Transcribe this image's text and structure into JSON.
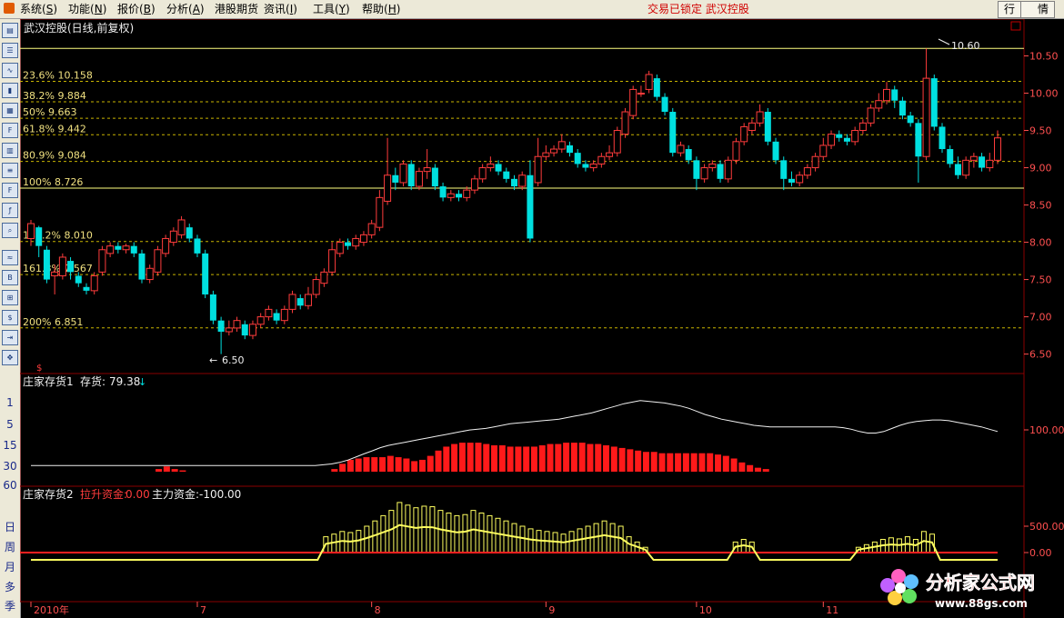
{
  "menu": {
    "items": [
      "系统",
      "功能",
      "报价",
      "分析",
      "港股期货",
      "资讯",
      "工具",
      "帮助"
    ],
    "item_keys": [
      "S",
      "N",
      "B",
      "A",
      "",
      "I",
      "Y",
      "H"
    ],
    "status": "交易已锁定 武汉控股",
    "right_buttons": [
      "行",
      "情"
    ]
  },
  "toolbar": {
    "periods": [
      "1",
      "5",
      "15",
      "30",
      "60"
    ],
    "cycles": [
      "日",
      "周",
      "月",
      "多",
      "季"
    ]
  },
  "main_panel": {
    "title": "武汉控股(日线,前复权)",
    "high_label": "10.60",
    "low_label": "6.50",
    "fib_levels": [
      {
        "label": "23.6% 10.158",
        "price": 10.158
      },
      {
        "label": "38.2% 9.884",
        "price": 9.884
      },
      {
        "label": "50% 9.663",
        "price": 9.663
      },
      {
        "label": "61.8% 9.442",
        "price": 9.442
      },
      {
        "label": "80.9% 9.084",
        "price": 9.084
      },
      {
        "label": "100% 8.726",
        "price": 8.726
      },
      {
        "label": "138.2% 8.010",
        "price": 8.01
      },
      {
        "label": "161.8% 7.567",
        "price": 7.567
      },
      {
        "label": "200% 6.851",
        "price": 6.851
      }
    ],
    "yaxis_ticks": [
      "10.50",
      "10.00",
      "9.50",
      "9.00",
      "8.50",
      "8.00",
      "7.50",
      "7.00",
      "6.50"
    ],
    "yaxis_values": [
      10.5,
      10.0,
      9.5,
      9.0,
      8.5,
      8.0,
      7.5,
      7.0,
      6.5
    ],
    "ymin": 6.3,
    "ymax": 10.75
  },
  "sub_panel_1": {
    "name": "庄家存货1",
    "indicator_label": "存货:",
    "indicator_value": "79.38",
    "tick_label": "100.00",
    "tick_value": 100
  },
  "sub_panel_2": {
    "name": "庄家存货2",
    "pull_label": "拉升资金:",
    "pull_value": "0.00",
    "main_label": "主力资金:",
    "main_value": "-100.00",
    "ticks": [
      "500.00",
      "0.00"
    ],
    "tick_values": [
      500,
      0
    ]
  },
  "xaxis": {
    "labels": [
      {
        "text": "2010年",
        "index": 0
      },
      {
        "text": "7",
        "index": 21
      },
      {
        "text": "8",
        "index": 43
      },
      {
        "text": "9",
        "index": 65
      },
      {
        "text": "10",
        "index": 84
      },
      {
        "text": "11",
        "index": 100
      }
    ]
  },
  "watermark": {
    "title": "分析家公式网",
    "url": "www.88gs.com"
  },
  "colors": {
    "up": "#ff3c3c",
    "down": "#00e0e0",
    "fib_dash": "#c8b400",
    "fib_solid": "#ffff80",
    "grid_red": "#8a0000",
    "axis_text": "#ff5050",
    "cream": "#f0e080"
  },
  "chart_data": {
    "type": "candlestick",
    "candles": [
      [
        8.05,
        8.25,
        8.3,
        7.95
      ],
      [
        8.2,
        7.95,
        8.22,
        7.8
      ],
      [
        7.9,
        7.5,
        7.95,
        7.45
      ],
      [
        7.55,
        7.6,
        7.7,
        7.3
      ],
      [
        7.55,
        7.8,
        7.85,
        7.5
      ],
      [
        7.75,
        7.6,
        7.8,
        7.5
      ],
      [
        7.55,
        7.45,
        7.6,
        7.4
      ],
      [
        7.4,
        7.35,
        7.45,
        7.3
      ],
      [
        7.35,
        7.55,
        7.6,
        7.3
      ],
      [
        7.6,
        7.9,
        7.95,
        7.55
      ],
      [
        7.85,
        7.95,
        8.0,
        7.8
      ],
      [
        7.95,
        7.9,
        8.0,
        7.85
      ],
      [
        7.9,
        7.95,
        7.98,
        7.85
      ],
      [
        7.95,
        7.85,
        8.0,
        7.8
      ],
      [
        7.85,
        7.5,
        7.9,
        7.45
      ],
      [
        7.5,
        7.65,
        7.7,
        7.45
      ],
      [
        7.6,
        7.9,
        7.95,
        7.55
      ],
      [
        7.85,
        8.05,
        8.1,
        7.8
      ],
      [
        8.0,
        8.15,
        8.2,
        7.95
      ],
      [
        8.1,
        8.3,
        8.35,
        8.05
      ],
      [
        8.2,
        8.05,
        8.25,
        8.0
      ],
      [
        8.05,
        7.85,
        8.1,
        7.8
      ],
      [
        7.85,
        7.3,
        7.9,
        7.25
      ],
      [
        7.3,
        6.95,
        7.35,
        6.9
      ],
      [
        6.95,
        6.8,
        7.0,
        6.5
      ],
      [
        6.8,
        6.85,
        6.95,
        6.75
      ],
      [
        6.85,
        6.95,
        7.0,
        6.8
      ],
      [
        6.9,
        6.75,
        6.95,
        6.7
      ],
      [
        6.75,
        6.9,
        6.95,
        6.7
      ],
      [
        6.9,
        7.0,
        7.05,
        6.85
      ],
      [
        7.0,
        7.1,
        7.15,
        6.95
      ],
      [
        7.05,
        6.95,
        7.1,
        6.9
      ],
      [
        6.95,
        7.1,
        7.15,
        6.9
      ],
      [
        7.1,
        7.3,
        7.35,
        7.05
      ],
      [
        7.25,
        7.15,
        7.3,
        7.1
      ],
      [
        7.15,
        7.3,
        7.4,
        7.1
      ],
      [
        7.3,
        7.5,
        7.55,
        7.25
      ],
      [
        7.45,
        7.6,
        7.65,
        7.4
      ],
      [
        7.6,
        7.9,
        8.0,
        7.55
      ],
      [
        7.85,
        8.0,
        8.05,
        7.8
      ],
      [
        8.0,
        7.95,
        8.05,
        7.9
      ],
      [
        7.95,
        8.05,
        8.1,
        7.9
      ],
      [
        8.0,
        8.1,
        8.15,
        7.95
      ],
      [
        8.1,
        8.25,
        8.3,
        8.05
      ],
      [
        8.2,
        8.6,
        8.7,
        8.15
      ],
      [
        8.55,
        8.9,
        9.4,
        8.5
      ],
      [
        8.9,
        8.8,
        9.0,
        8.7
      ],
      [
        8.8,
        9.05,
        9.1,
        8.75
      ],
      [
        9.05,
        8.75,
        9.1,
        8.7
      ],
      [
        8.75,
        8.95,
        9.0,
        8.7
      ],
      [
        8.95,
        9.0,
        9.25,
        8.85
      ],
      [
        9.0,
        8.75,
        9.05,
        8.7
      ],
      [
        8.75,
        8.6,
        8.8,
        8.55
      ],
      [
        8.6,
        8.65,
        8.7,
        8.55
      ],
      [
        8.65,
        8.6,
        8.7,
        8.55
      ],
      [
        8.6,
        8.7,
        8.75,
        8.55
      ],
      [
        8.7,
        8.85,
        8.9,
        8.65
      ],
      [
        8.85,
        9.0,
        9.05,
        8.8
      ],
      [
        9.0,
        9.05,
        9.15,
        8.95
      ],
      [
        9.05,
        8.95,
        9.1,
        8.9
      ],
      [
        8.95,
        8.85,
        9.0,
        8.8
      ],
      [
        8.85,
        8.75,
        8.9,
        8.7
      ],
      [
        8.75,
        8.9,
        8.95,
        8.7
      ],
      [
        8.9,
        8.05,
        9.1,
        8.0
      ],
      [
        8.8,
        9.15,
        9.4,
        8.75
      ],
      [
        9.15,
        9.2,
        9.3,
        9.1
      ],
      [
        9.2,
        9.25,
        9.3,
        9.15
      ],
      [
        9.25,
        9.35,
        9.45,
        9.2
      ],
      [
        9.3,
        9.2,
        9.35,
        9.15
      ],
      [
        9.2,
        9.05,
        9.25,
        9.0
      ],
      [
        9.05,
        9.0,
        9.1,
        8.95
      ],
      [
        9.0,
        9.05,
        9.1,
        8.95
      ],
      [
        9.05,
        9.15,
        9.2,
        9.0
      ],
      [
        9.15,
        9.2,
        9.3,
        9.1
      ],
      [
        9.2,
        9.5,
        9.55,
        9.15
      ],
      [
        9.45,
        9.75,
        9.8,
        9.4
      ],
      [
        9.7,
        10.05,
        10.1,
        9.65
      ],
      [
        10.0,
        10.0,
        10.1,
        9.95
      ],
      [
        10.05,
        10.25,
        10.3,
        10.0
      ],
      [
        10.2,
        9.95,
        10.25,
        9.9
      ],
      [
        9.95,
        9.75,
        10.0,
        9.7
      ],
      [
        9.75,
        9.2,
        9.8,
        9.15
      ],
      [
        9.2,
        9.3,
        9.35,
        9.15
      ],
      [
        9.25,
        9.1,
        9.3,
        9.05
      ],
      [
        9.1,
        8.85,
        9.15,
        8.7
      ],
      [
        8.85,
        9.0,
        9.05,
        8.8
      ],
      [
        9.0,
        9.05,
        9.1,
        8.95
      ],
      [
        9.05,
        8.85,
        9.1,
        8.8
      ],
      [
        8.85,
        9.1,
        9.15,
        8.8
      ],
      [
        9.1,
        9.35,
        9.4,
        9.05
      ],
      [
        9.35,
        9.55,
        9.6,
        9.3
      ],
      [
        9.5,
        9.6,
        9.65,
        9.45
      ],
      [
        9.6,
        9.75,
        9.85,
        9.55
      ],
      [
        9.75,
        9.35,
        9.8,
        9.3
      ],
      [
        9.35,
        9.1,
        9.4,
        9.05
      ],
      [
        9.1,
        8.85,
        9.15,
        8.7
      ],
      [
        8.85,
        8.8,
        8.95,
        8.75
      ],
      [
        8.8,
        8.9,
        8.95,
        8.75
      ],
      [
        8.9,
        9.0,
        9.05,
        8.85
      ],
      [
        9.0,
        9.15,
        9.2,
        8.95
      ],
      [
        9.15,
        9.3,
        9.4,
        9.1
      ],
      [
        9.3,
        9.45,
        9.5,
        9.25
      ],
      [
        9.45,
        9.4,
        9.5,
        9.35
      ],
      [
        9.4,
        9.35,
        9.45,
        9.3
      ],
      [
        9.35,
        9.5,
        9.55,
        9.3
      ],
      [
        9.5,
        9.6,
        9.65,
        9.45
      ],
      [
        9.6,
        9.8,
        9.85,
        9.55
      ],
      [
        9.8,
        9.9,
        10.0,
        9.75
      ],
      [
        9.9,
        10.05,
        10.15,
        9.85
      ],
      [
        10.05,
        9.9,
        10.1,
        9.8
      ],
      [
        9.9,
        9.7,
        9.95,
        9.65
      ],
      [
        9.7,
        9.6,
        9.75,
        9.55
      ],
      [
        9.6,
        9.15,
        9.65,
        8.8
      ],
      [
        9.15,
        10.2,
        10.6,
        9.1
      ],
      [
        10.2,
        9.55,
        10.25,
        9.5
      ],
      [
        9.55,
        9.25,
        9.6,
        9.2
      ],
      [
        9.25,
        9.05,
        9.3,
        9.0
      ],
      [
        9.05,
        8.9,
        9.15,
        8.85
      ],
      [
        8.9,
        9.1,
        9.15,
        8.85
      ],
      [
        9.1,
        9.15,
        9.2,
        9.0
      ],
      [
        9.15,
        9.0,
        9.2,
        8.95
      ],
      [
        9.0,
        9.1,
        9.2,
        8.95
      ],
      [
        9.1,
        9.4,
        9.5,
        9.05
      ]
    ],
    "inventory": [
      0,
      0,
      0,
      0,
      0,
      0,
      0,
      0,
      0,
      0,
      0,
      0,
      0,
      0,
      0,
      0,
      2,
      4,
      2,
      1,
      0,
      0,
      0,
      0,
      0,
      0,
      0,
      0,
      0,
      0,
      0,
      0,
      0,
      0,
      0,
      0,
      0,
      0,
      2,
      6,
      9,
      10,
      11,
      11,
      11,
      12,
      11,
      10,
      8,
      9,
      12,
      16,
      19,
      21,
      22,
      22,
      22,
      21,
      20,
      20,
      19,
      19,
      19,
      19,
      20,
      21,
      21,
      22,
      22,
      22,
      21,
      21,
      20,
      19,
      18,
      17,
      16,
      15,
      15,
      14,
      14,
      14,
      14,
      14,
      14,
      14,
      13,
      12,
      10,
      7,
      5,
      3,
      2,
      0,
      0,
      0,
      0,
      0,
      0,
      0,
      0,
      0,
      0,
      0,
      0,
      0,
      0,
      0,
      0,
      0,
      0,
      0,
      0,
      0,
      0,
      0,
      0,
      0,
      0,
      0,
      0,
      0
    ],
    "inventory_line": [
      0.08,
      0.08,
      0.08,
      0.08,
      0.08,
      0.08,
      0.08,
      0.08,
      0.08,
      0.08,
      0.08,
      0.08,
      0.08,
      0.08,
      0.08,
      0.08,
      0.08,
      0.08,
      0.08,
      0.08,
      0.08,
      0.08,
      0.08,
      0.08,
      0.08,
      0.08,
      0.08,
      0.08,
      0.08,
      0.08,
      0.08,
      0.08,
      0.08,
      0.08,
      0.08,
      0.08,
      0.09,
      0.1,
      0.12,
      0.15,
      0.19,
      0.23,
      0.27,
      0.31,
      0.34,
      0.36,
      0.38,
      0.4,
      0.42,
      0.44,
      0.46,
      0.48,
      0.5,
      0.52,
      0.54,
      0.55,
      0.56,
      0.58,
      0.6,
      0.62,
      0.63,
      0.64,
      0.65,
      0.66,
      0.67,
      0.68,
      0.7,
      0.72,
      0.74,
      0.76,
      0.79,
      0.82,
      0.85,
      0.88,
      0.9,
      0.92,
      0.91,
      0.9,
      0.89,
      0.87,
      0.85,
      0.82,
      0.78,
      0.74,
      0.71,
      0.68,
      0.66,
      0.64,
      0.62,
      0.6,
      0.59,
      0.58,
      0.58,
      0.58,
      0.58,
      0.58,
      0.58,
      0.58,
      0.58,
      0.58,
      0.57,
      0.55,
      0.52,
      0.5,
      0.5,
      0.52,
      0.56,
      0.6,
      0.63,
      0.65,
      0.66,
      0.67,
      0.67,
      0.66,
      0.64,
      0.62,
      0.6,
      0.58,
      0.55,
      0.52
    ],
    "funds": [
      0,
      0,
      0,
      0,
      0,
      0,
      0,
      0,
      0,
      0,
      0,
      0,
      0,
      0,
      0,
      0,
      0,
      0,
      0,
      0,
      0,
      0,
      0,
      0,
      0,
      0,
      0,
      0,
      0,
      0,
      0,
      0,
      0,
      0,
      0,
      0,
      300,
      350,
      400,
      380,
      420,
      500,
      600,
      700,
      800,
      950,
      900,
      850,
      880,
      870,
      800,
      750,
      700,
      720,
      800,
      750,
      700,
      650,
      600,
      550,
      500,
      450,
      420,
      400,
      380,
      350,
      400,
      450,
      500,
      550,
      600,
      550,
      500,
      300,
      200,
      100,
      0,
      0,
      0,
      0,
      0,
      0,
      0,
      0,
      0,
      0,
      200,
      250,
      200,
      0,
      0,
      0,
      0,
      0,
      0,
      0,
      0,
      0,
      0,
      0,
      0,
      100,
      150,
      200,
      250,
      280,
      260,
      300,
      250,
      400,
      350,
      0,
      0,
      0,
      0,
      0,
      0,
      0,
      0
    ]
  }
}
